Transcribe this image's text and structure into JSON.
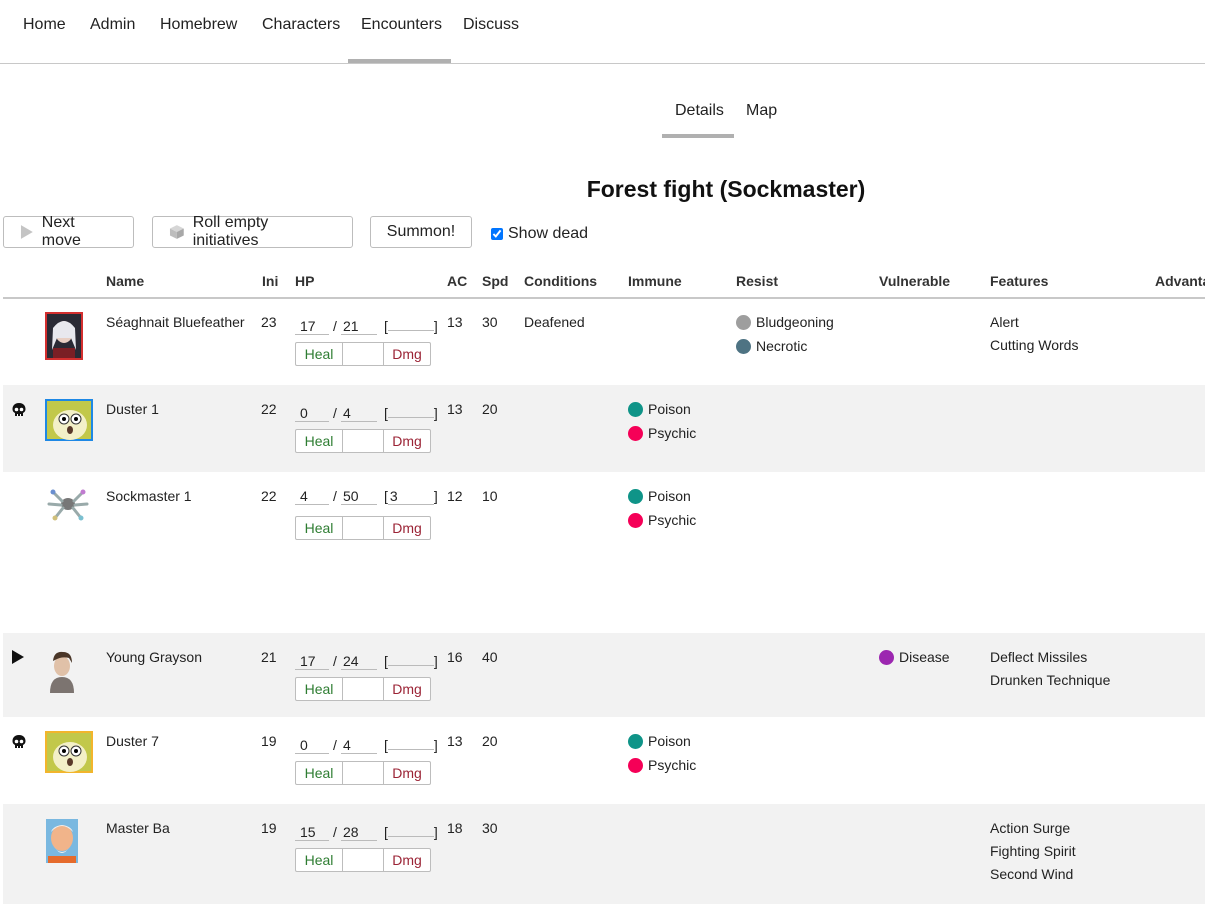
{
  "nav": {
    "items": [
      "Home",
      "Admin",
      "Homebrew",
      "Characters",
      "Encounters",
      "Discuss"
    ],
    "active": "Encounters"
  },
  "subtabs": {
    "items": [
      "Details",
      "Map"
    ],
    "active": "Details"
  },
  "title": "Forest fight (Sockmaster)",
  "toolbar": {
    "next_move": "Next move",
    "roll_initiatives": "Roll empty initiatives",
    "summon": "Summon!",
    "show_dead": "Show dead",
    "show_dead_checked": true
  },
  "columns": [
    "Name",
    "Ini",
    "HP",
    "AC",
    "Spd",
    "Conditions",
    "Immune",
    "Resist",
    "Vulnerable",
    "Features",
    "Advanta"
  ],
  "hp_labels": {
    "heal": "Heal",
    "dmg": "Dmg",
    "sep": "/",
    "open": "[",
    "close": "]"
  },
  "colors": {
    "Bludgeoning": "#9e9e9e",
    "Necrotic": "#4e7383",
    "Poison": "#0f9488",
    "Psychic": "#f50057",
    "Disease": "#9c27b0",
    "heal": "#2e7d32",
    "dmg": "#9b2335"
  },
  "rows": [
    {
      "name": "Séaghnait Bluefeather",
      "ini": "23",
      "hp_current": "17",
      "hp_max": "21",
      "hp_temp": "",
      "ac": "13",
      "spd": "30",
      "conditions": "Deafened",
      "status": "",
      "avatar": "elf-portrait",
      "immune": [],
      "resist": [
        "Bludgeoning",
        "Necrotic"
      ],
      "vulnerable": [],
      "features": [
        "Alert",
        "Cutting Words"
      ]
    },
    {
      "name": "Duster 1",
      "ini": "22",
      "hp_current": "0",
      "hp_max": "4",
      "hp_temp": "",
      "ac": "13",
      "spd": "20",
      "conditions": "",
      "status": "dead",
      "avatar": "duster-blob-blue",
      "immune": [
        "Poison",
        "Psychic"
      ],
      "resist": [],
      "vulnerable": [],
      "features": []
    },
    {
      "name": "Sockmaster 1",
      "ini": "22",
      "hp_current": "4",
      "hp_max": "50",
      "hp_temp": "3",
      "ac": "12",
      "spd": "10",
      "conditions": "",
      "status": "",
      "avatar": "sockmaster-spider",
      "immune": [
        "Poison",
        "Psychic"
      ],
      "resist": [],
      "vulnerable": [],
      "features": []
    },
    {
      "name": "Young Grayson",
      "ini": "21",
      "hp_current": "17",
      "hp_max": "24",
      "hp_temp": "",
      "ac": "16",
      "spd": "40",
      "conditions": "",
      "status": "current",
      "avatar": "monk-portrait",
      "immune": [],
      "resist": [],
      "vulnerable": [
        "Disease"
      ],
      "features": [
        "Deflect Missiles",
        "Drunken Technique"
      ]
    },
    {
      "name": "Duster 7",
      "ini": "19",
      "hp_current": "0",
      "hp_max": "4",
      "hp_temp": "",
      "ac": "13",
      "spd": "20",
      "conditions": "",
      "status": "dead",
      "avatar": "duster-blob-yellow",
      "immune": [
        "Poison",
        "Psychic"
      ],
      "resist": [],
      "vulnerable": [],
      "features": []
    },
    {
      "name": "Master Ba",
      "ini": "19",
      "hp_current": "15",
      "hp_max": "28",
      "hp_temp": "",
      "ac": "18",
      "spd": "30",
      "conditions": "",
      "status": "",
      "avatar": "old-master-portrait",
      "immune": [],
      "resist": [],
      "vulnerable": [],
      "features": [
        "Action Surge",
        "Fighting Spirit",
        "Second Wind"
      ]
    }
  ]
}
